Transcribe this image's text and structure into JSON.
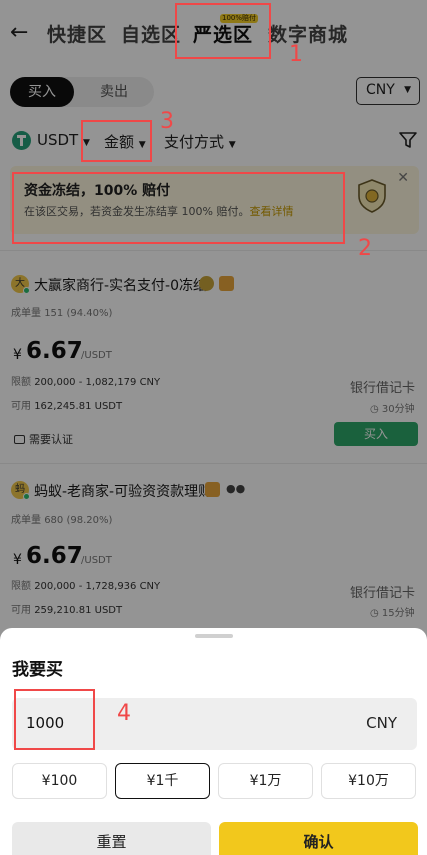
{
  "header": {
    "back_icon": "arrow-left-icon",
    "tabs": [
      {
        "label": "快捷区"
      },
      {
        "label": "自选区"
      },
      {
        "label": "严选区",
        "badge": "100%赔付"
      },
      {
        "label": "数字商城"
      }
    ]
  },
  "trade": {
    "buy_label": "买入",
    "sell_label": "卖出",
    "currency": "CNY"
  },
  "filters": {
    "coin": "USDT",
    "amount_label": "金额",
    "payment_label": "支付方式",
    "filter_icon": "funnel-icon"
  },
  "banner": {
    "title": "资金冻结，100% 赔付",
    "desc": "在该区交易，若资金发生冻结享 100% 赔付。",
    "link": "查看详情",
    "icon": "shield-icon"
  },
  "listings": [
    {
      "avatar": "大",
      "name": "大赢家商行-实名支付-0冻结",
      "volume_label": "成单量",
      "volume": "151 (94.40%)",
      "currency_symbol": "¥",
      "price": "6.67",
      "unit": "/USDT",
      "limit_label": "限额",
      "limit": "200,000 - 1,082,179 CNY",
      "available_label": "可用",
      "available": "162,245.81 USDT",
      "payment": "银行借记卡",
      "time": "30分钟",
      "buy_label": "买入",
      "verify_label": "需要认证"
    },
    {
      "avatar": "蚂",
      "name": "蚂蚁-老商家-可验资资款理财",
      "volume_label": "成单量",
      "volume": "680 (98.20%)",
      "currency_symbol": "¥",
      "price": "6.67",
      "unit": "/USDT",
      "limit_label": "限额",
      "limit": "200,000 - 1,728,936 CNY",
      "available_label": "可用",
      "available": "259,210.81 USDT",
      "payment": "银行借记卡",
      "time": "15分钟"
    }
  ],
  "sheet": {
    "title": "我要买",
    "amount_value": "1000",
    "amount_currency": "CNY",
    "presets": [
      "¥100",
      "¥1千",
      "¥1万",
      "¥10万"
    ],
    "selected_preset": "¥1千",
    "reset_label": "重置",
    "confirm_label": "确认"
  },
  "annotations": [
    "1",
    "2",
    "3",
    "4"
  ],
  "colors": {
    "accent": "#f2c81c",
    "buy_green": "#2ea86a",
    "annotation_red": "#f04848",
    "banner_bg": "#fdf7de"
  }
}
